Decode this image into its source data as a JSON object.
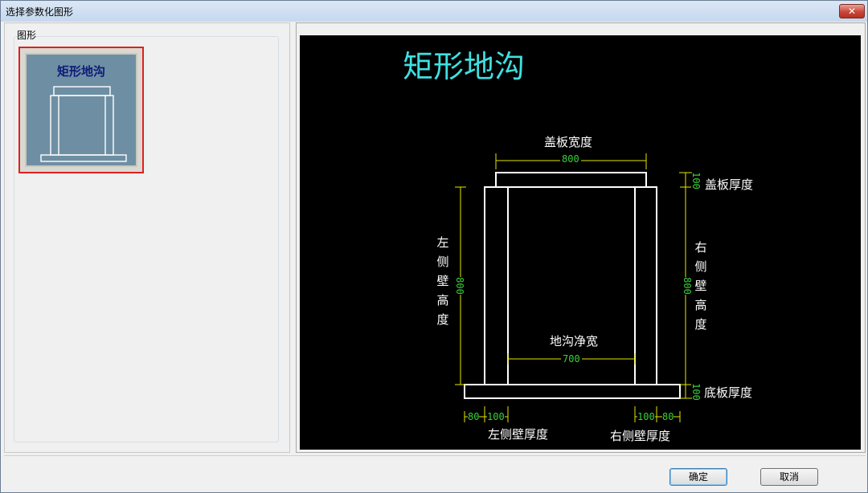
{
  "window": {
    "title": "选择参数化图形",
    "close_glyph": "✕"
  },
  "left": {
    "group_label": "图形",
    "items": [
      {
        "label": "矩形地沟",
        "selected": true
      }
    ]
  },
  "preview": {
    "title": "矩形地沟",
    "labels": {
      "cover_width": "盖板宽度",
      "cover_thickness": "盖板厚度",
      "left_wall_height": "左侧壁高度",
      "right_wall_height": "右侧壁高度",
      "clear_width": "地沟净宽",
      "bottom_thickness": "底板厚度",
      "left_wall_thickness": "左侧壁厚度",
      "right_wall_thickness": "右侧壁厚度"
    },
    "dims": {
      "cover_width": "800",
      "cover_thickness": "100",
      "left_wall_height": "800",
      "right_wall_height": "800",
      "clear_width": "700",
      "bottom_thickness": "100",
      "left_outer": "80",
      "left_wall": "100",
      "right_wall": "100",
      "right_outer": "80"
    },
    "colors": {
      "background": "#000000",
      "title": "#3fe0e0",
      "dimension": "#37d237",
      "dim_line": "#e6e600",
      "outline": "#ffffff"
    }
  },
  "buttons": {
    "ok": "确定",
    "cancel": "取消"
  }
}
